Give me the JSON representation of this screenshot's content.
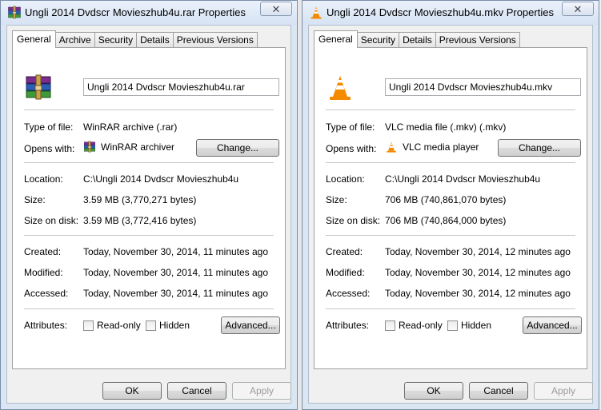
{
  "left": {
    "title": "Ungli 2014 Dvdscr Movieszhub4u.rar Properties",
    "close_symbol": "✕",
    "tabs": [
      "General",
      "Archive",
      "Security",
      "Details",
      "Previous Versions"
    ],
    "file_name": "Ungli 2014 Dvdscr Movieszhub4u.rar",
    "type_label": "Type of file:",
    "type_value": "WinRAR archive (.rar)",
    "opens_label": "Opens with:",
    "opens_value": "WinRAR archiver",
    "change_label": "Change...",
    "location_label": "Location:",
    "location_value": "C:\\Ungli 2014 Dvdscr Movieszhub4u",
    "size_label": "Size:",
    "size_value": "3.59 MB (3,770,271 bytes)",
    "size_disk_label": "Size on disk:",
    "size_disk_value": "3.59 MB (3,772,416 bytes)",
    "created_label": "Created:",
    "created_value": "Today, November 30, 2014, 11 minutes ago",
    "modified_label": "Modified:",
    "modified_value": "Today, November 30, 2014, 11 minutes ago",
    "accessed_label": "Accessed:",
    "accessed_value": "Today, November 30, 2014, 11 minutes ago",
    "attributes_label": "Attributes:",
    "readonly_label": "Read-only",
    "hidden_label": "Hidden",
    "advanced_label": "Advanced...",
    "ok_label": "OK",
    "cancel_label": "Cancel",
    "apply_label": "Apply",
    "icon": "winrar-archive-icon"
  },
  "right": {
    "title": "Ungli 2014 Dvdscr Movieszhub4u.mkv Properties",
    "close_symbol": "✕",
    "tabs": [
      "General",
      "Security",
      "Details",
      "Previous Versions"
    ],
    "file_name": "Ungli 2014 Dvdscr Movieszhub4u.mkv",
    "type_label": "Type of file:",
    "type_value": "VLC media file (.mkv) (.mkv)",
    "opens_label": "Opens with:",
    "opens_value": "VLC media player",
    "change_label": "Change...",
    "location_label": "Location:",
    "location_value": "C:\\Ungli 2014 Dvdscr Movieszhub4u",
    "size_label": "Size:",
    "size_value": "706 MB (740,861,070 bytes)",
    "size_disk_label": "Size on disk:",
    "size_disk_value": "706 MB (740,864,000 bytes)",
    "created_label": "Created:",
    "created_value": "Today, November 30, 2014, 12 minutes ago",
    "modified_label": "Modified:",
    "modified_value": "Today, November 30, 2014, 12 minutes ago",
    "accessed_label": "Accessed:",
    "accessed_value": "Today, November 30, 2014, 12 minutes ago",
    "attributes_label": "Attributes:",
    "readonly_label": "Read-only",
    "hidden_label": "Hidden",
    "advanced_label": "Advanced...",
    "ok_label": "OK",
    "cancel_label": "Cancel",
    "apply_label": "Apply",
    "icon": "vlc-cone-icon"
  }
}
